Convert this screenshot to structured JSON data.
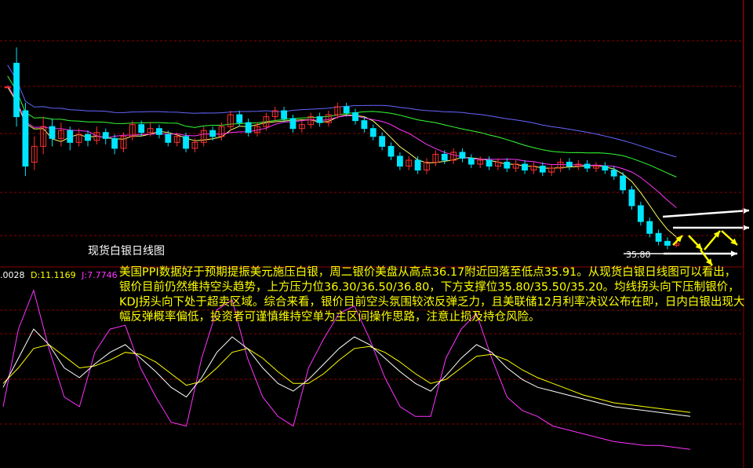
{
  "chart_title": "现货白银日线图",
  "commentary": "美国PPI数据好于预期提振美元施压白银，周二银价美盘从高点36.17附近回落至低点35.91。从现货白银日线图可以看出，银价目前仍然维持空头趋势，上方压力位36.30/36.50/36.80，下方支撑位35.80/35.50/35.20。均线拐头向下压制银价，KDJ拐头向下处于超卖区域。综合来看，银价目前空头氛围较浓反弹乏力，且美联储12月利率决议公布在即，日内白银出现大幅反弹概率偏低，投资者可谨慎维持空单为主区间操作思路，注意止损及持仓风险。",
  "kdj_readout": {
    "k": ".0028",
    "d": "D:11.1169",
    "j": "J:7.7746"
  },
  "price_marker": "35.80",
  "colors": {
    "background": "#000000",
    "grid": "#8b0000",
    "candle_up": "#ff3030",
    "candle_down": "#00e5ff",
    "ma_short": "#ffff66",
    "ma_mid": "#ff33ff",
    "ma_long1": "#33ff33",
    "ma_long2": "#6666ff",
    "kdj_k": "#ffffff",
    "kdj_d": "#ffff00",
    "kdj_j": "#ff33ff",
    "arrows": "#ffffff",
    "arrows_yellow": "#ffff00",
    "text": "#ffff00"
  },
  "chart_data": {
    "type": "candlestick",
    "title": "现货白银日线图",
    "candles": [
      [
        100,
        100,
        100,
        100
      ],
      [
        112,
        85,
        120,
        80
      ],
      [
        88,
        60,
        92,
        55
      ],
      [
        62,
        70,
        75,
        58
      ],
      [
        70,
        80,
        85,
        66
      ],
      [
        80,
        74,
        84,
        70
      ],
      [
        74,
        78,
        82,
        70
      ],
      [
        78,
        72,
        80,
        68
      ],
      [
        72,
        76,
        79,
        70
      ],
      [
        76,
        73,
        78,
        70
      ],
      [
        73,
        77,
        80,
        71
      ],
      [
        77,
        74,
        79,
        71
      ],
      [
        74,
        69,
        76,
        66
      ],
      [
        69,
        75,
        77,
        67
      ],
      [
        75,
        81,
        83,
        73
      ],
      [
        81,
        77,
        83,
        75
      ],
      [
        77,
        79,
        82,
        75
      ],
      [
        79,
        76,
        81,
        74
      ],
      [
        76,
        72,
        78,
        70
      ],
      [
        72,
        75,
        77,
        70
      ],
      [
        75,
        69,
        77,
        67
      ],
      [
        69,
        72,
        74,
        67
      ],
      [
        72,
        78,
        80,
        70
      ],
      [
        78,
        75,
        80,
        73
      ],
      [
        75,
        80,
        82,
        73
      ],
      [
        80,
        86,
        88,
        78
      ],
      [
        86,
        82,
        88,
        80
      ],
      [
        82,
        77,
        84,
        75
      ],
      [
        77,
        80,
        82,
        75
      ],
      [
        80,
        85,
        87,
        78
      ],
      [
        85,
        88,
        90,
        83
      ],
      [
        88,
        84,
        90,
        82
      ],
      [
        84,
        79,
        86,
        77
      ],
      [
        79,
        81,
        83,
        77
      ],
      [
        81,
        85,
        87,
        79
      ],
      [
        85,
        82,
        87,
        80
      ],
      [
        82,
        86,
        88,
        80
      ],
      [
        86,
        90,
        92,
        84
      ],
      [
        90,
        87,
        92,
        85
      ],
      [
        87,
        83,
        89,
        81
      ],
      [
        83,
        79,
        85,
        77
      ],
      [
        79,
        75,
        81,
        73
      ],
      [
        75,
        70,
        77,
        68
      ],
      [
        70,
        65,
        72,
        63
      ],
      [
        65,
        60,
        67,
        58
      ],
      [
        60,
        63,
        65,
        58
      ],
      [
        63,
        58,
        65,
        56
      ],
      [
        58,
        62,
        64,
        56
      ],
      [
        62,
        66,
        68,
        60
      ],
      [
        66,
        63,
        68,
        61
      ],
      [
        63,
        67,
        69,
        61
      ],
      [
        67,
        64,
        69,
        62
      ],
      [
        64,
        61,
        66,
        59
      ],
      [
        61,
        63,
        65,
        59
      ],
      [
        63,
        60,
        65,
        58
      ],
      [
        60,
        62,
        64,
        58
      ],
      [
        62,
        59,
        64,
        57
      ],
      [
        59,
        61,
        63,
        57
      ],
      [
        61,
        58,
        63,
        56
      ],
      [
        58,
        60,
        62,
        56
      ],
      [
        60,
        57,
        62,
        55
      ],
      [
        57,
        59,
        61,
        55
      ],
      [
        59,
        62,
        64,
        57
      ],
      [
        62,
        60,
        64,
        58
      ],
      [
        60,
        61,
        63,
        58
      ],
      [
        61,
        59,
        63,
        57
      ],
      [
        59,
        60,
        62,
        57
      ],
      [
        60,
        58,
        62,
        56
      ],
      [
        58,
        55,
        60,
        53
      ],
      [
        55,
        48,
        57,
        46
      ],
      [
        48,
        40,
        50,
        38
      ],
      [
        40,
        32,
        42,
        30
      ],
      [
        32,
        26,
        34,
        24
      ],
      [
        26,
        22,
        28,
        20
      ],
      [
        22,
        20,
        24,
        18
      ],
      [
        20,
        21,
        23,
        19
      ]
    ],
    "kdj": {
      "k": [
        40,
        55,
        70,
        62,
        50,
        45,
        52,
        58,
        62,
        55,
        48,
        40,
        35,
        45,
        58,
        66,
        60,
        50,
        42,
        38,
        44,
        52,
        60,
        66,
        62,
        55,
        48,
        42,
        38,
        46,
        55,
        62,
        58,
        50,
        44,
        40,
        38,
        36,
        34,
        32,
        30,
        29,
        28,
        27,
        26,
        25
      ],
      "d": [
        42,
        50,
        60,
        62,
        56,
        50,
        51,
        54,
        58,
        57,
        53,
        47,
        41,
        43,
        50,
        58,
        60,
        55,
        48,
        42,
        42,
        47,
        54,
        60,
        61,
        58,
        53,
        47,
        42,
        44,
        50,
        56,
        57,
        54,
        49,
        45,
        42,
        39,
        36,
        34,
        32,
        31,
        30,
        29,
        28,
        27
      ],
      "j": [
        30,
        70,
        90,
        60,
        35,
        30,
        58,
        70,
        72,
        50,
        35,
        22,
        20,
        55,
        80,
        85,
        55,
        35,
        25,
        20,
        50,
        65,
        78,
        82,
        65,
        45,
        30,
        25,
        25,
        55,
        70,
        78,
        55,
        35,
        28,
        25,
        20,
        18,
        16,
        14,
        12,
        11,
        10,
        10,
        9,
        8
      ]
    },
    "ylabel": "",
    "xlabel": ""
  }
}
